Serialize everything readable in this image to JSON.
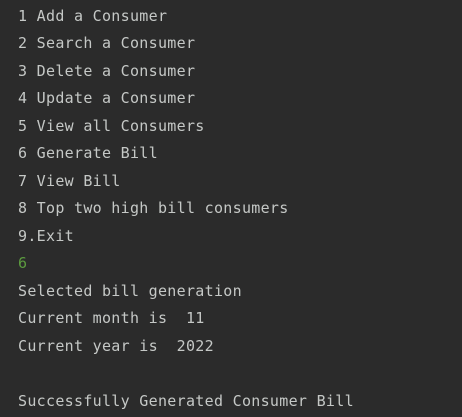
{
  "console": {
    "menu": [
      "1 Add a Consumer",
      "2 Search a Consumer",
      "3 Delete a Consumer",
      "4 Update a Consumer",
      "5 View all Consumers",
      "6 Generate Bill",
      "7 View Bill",
      "8 Top two high bill consumers",
      "9.Exit"
    ],
    "user_input": "6",
    "output": [
      "Selected bill generation",
      "Current month is  11",
      "Current year is  2022",
      "",
      "Successfully Generated Consumer Bill"
    ]
  },
  "colors": {
    "background": "#2b2b2b",
    "text": "#c5c8c6",
    "input": "#5c9c3f"
  }
}
